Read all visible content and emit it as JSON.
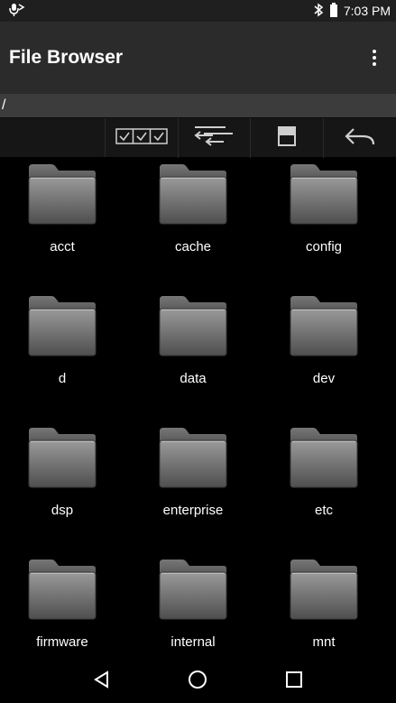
{
  "status_bar": {
    "time": "7:03 PM",
    "icons": [
      "mic-notification-icon",
      "bluetooth-icon",
      "battery-icon"
    ]
  },
  "app_bar": {
    "title": "File Browser",
    "overflow_icon": "more-vertical-icon"
  },
  "path": "/",
  "toolbar": {
    "buttons": [
      {
        "name": "multi-select",
        "icon": "checkbox-row-icon"
      },
      {
        "name": "go-up",
        "icon": "up-directory-icon"
      },
      {
        "name": "save",
        "icon": "save-icon"
      },
      {
        "name": "back",
        "icon": "back-arrow-icon"
      }
    ]
  },
  "folders": [
    {
      "label": "acct"
    },
    {
      "label": "cache"
    },
    {
      "label": "config"
    },
    {
      "label": "d"
    },
    {
      "label": "data"
    },
    {
      "label": "dev"
    },
    {
      "label": "dsp"
    },
    {
      "label": "enterprise"
    },
    {
      "label": "etc"
    },
    {
      "label": "firmware"
    },
    {
      "label": "internal"
    },
    {
      "label": "mnt"
    }
  ],
  "nav_bar": {
    "buttons": [
      "back-triangle-icon",
      "home-circle-icon",
      "recents-square-icon"
    ]
  },
  "colors": {
    "status_bar_bg": "#1f1f1f",
    "app_bar_bg": "#2b2b2b",
    "path_bar_bg": "#3c3c3c",
    "toolbar_bg": "#161616",
    "folder_gray": "#8a8a8a"
  }
}
